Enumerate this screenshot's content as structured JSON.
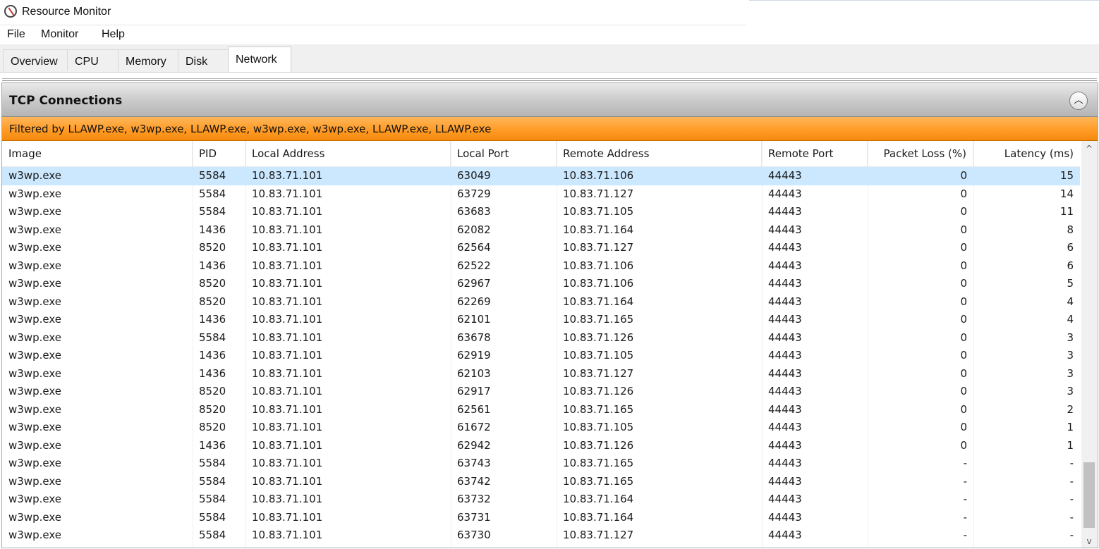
{
  "window": {
    "title": "Resource Monitor"
  },
  "menu": {
    "file": "File",
    "monitor": "Monitor",
    "help": "Help"
  },
  "tabs": {
    "overview": "Overview",
    "cpu": "CPU",
    "memory": "Memory",
    "disk": "Disk",
    "network": "Network"
  },
  "section": {
    "title": "TCP Connections",
    "collapse_glyph": "︿",
    "filter_text": "Filtered by LLAWP.exe, w3wp.exe, LLAWP.exe, w3wp.exe, w3wp.exe, LLAWP.exe, LLAWP.exe"
  },
  "table": {
    "columns": {
      "image": "Image",
      "pid": "PID",
      "local_address": "Local Address",
      "local_port": "Local Port",
      "remote_address": "Remote Address",
      "remote_port": "Remote Port",
      "packet_loss": "Packet Loss (%)",
      "latency": "Latency (ms)"
    },
    "sort_glyph": "^",
    "selected_row": 0,
    "rows": [
      [
        "w3wp.exe",
        "5584",
        "10.83.71.101",
        "63049",
        "10.83.71.106",
        "44443",
        "0",
        "15"
      ],
      [
        "w3wp.exe",
        "5584",
        "10.83.71.101",
        "63729",
        "10.83.71.127",
        "44443",
        "0",
        "14"
      ],
      [
        "w3wp.exe",
        "5584",
        "10.83.71.101",
        "63683",
        "10.83.71.105",
        "44443",
        "0",
        "11"
      ],
      [
        "w3wp.exe",
        "1436",
        "10.83.71.101",
        "62082",
        "10.83.71.164",
        "44443",
        "0",
        "8"
      ],
      [
        "w3wp.exe",
        "8520",
        "10.83.71.101",
        "62564",
        "10.83.71.127",
        "44443",
        "0",
        "6"
      ],
      [
        "w3wp.exe",
        "1436",
        "10.83.71.101",
        "62522",
        "10.83.71.106",
        "44443",
        "0",
        "6"
      ],
      [
        "w3wp.exe",
        "8520",
        "10.83.71.101",
        "62967",
        "10.83.71.106",
        "44443",
        "0",
        "5"
      ],
      [
        "w3wp.exe",
        "8520",
        "10.83.71.101",
        "62269",
        "10.83.71.164",
        "44443",
        "0",
        "4"
      ],
      [
        "w3wp.exe",
        "1436",
        "10.83.71.101",
        "62101",
        "10.83.71.165",
        "44443",
        "0",
        "4"
      ],
      [
        "w3wp.exe",
        "5584",
        "10.83.71.101",
        "63678",
        "10.83.71.126",
        "44443",
        "0",
        "3"
      ],
      [
        "w3wp.exe",
        "1436",
        "10.83.71.101",
        "62919",
        "10.83.71.105",
        "44443",
        "0",
        "3"
      ],
      [
        "w3wp.exe",
        "1436",
        "10.83.71.101",
        "62103",
        "10.83.71.127",
        "44443",
        "0",
        "3"
      ],
      [
        "w3wp.exe",
        "8520",
        "10.83.71.101",
        "62917",
        "10.83.71.126",
        "44443",
        "0",
        "3"
      ],
      [
        "w3wp.exe",
        "8520",
        "10.83.71.101",
        "62561",
        "10.83.71.165",
        "44443",
        "0",
        "2"
      ],
      [
        "w3wp.exe",
        "8520",
        "10.83.71.101",
        "61672",
        "10.83.71.105",
        "44443",
        "0",
        "1"
      ],
      [
        "w3wp.exe",
        "1436",
        "10.83.71.101",
        "62942",
        "10.83.71.126",
        "44443",
        "0",
        "1"
      ],
      [
        "w3wp.exe",
        "5584",
        "10.83.71.101",
        "63743",
        "10.83.71.165",
        "44443",
        "-",
        "-"
      ],
      [
        "w3wp.exe",
        "5584",
        "10.83.71.101",
        "63742",
        "10.83.71.165",
        "44443",
        "-",
        "-"
      ],
      [
        "w3wp.exe",
        "5584",
        "10.83.71.101",
        "63732",
        "10.83.71.164",
        "44443",
        "-",
        "-"
      ],
      [
        "w3wp.exe",
        "5584",
        "10.83.71.101",
        "63731",
        "10.83.71.164",
        "44443",
        "-",
        "-"
      ],
      [
        "w3wp.exe",
        "5584",
        "10.83.71.101",
        "63730",
        "10.83.71.127",
        "44443",
        "-",
        "-"
      ]
    ]
  },
  "scrollbar": {
    "up_glyph": "^",
    "down_glyph": "v"
  }
}
